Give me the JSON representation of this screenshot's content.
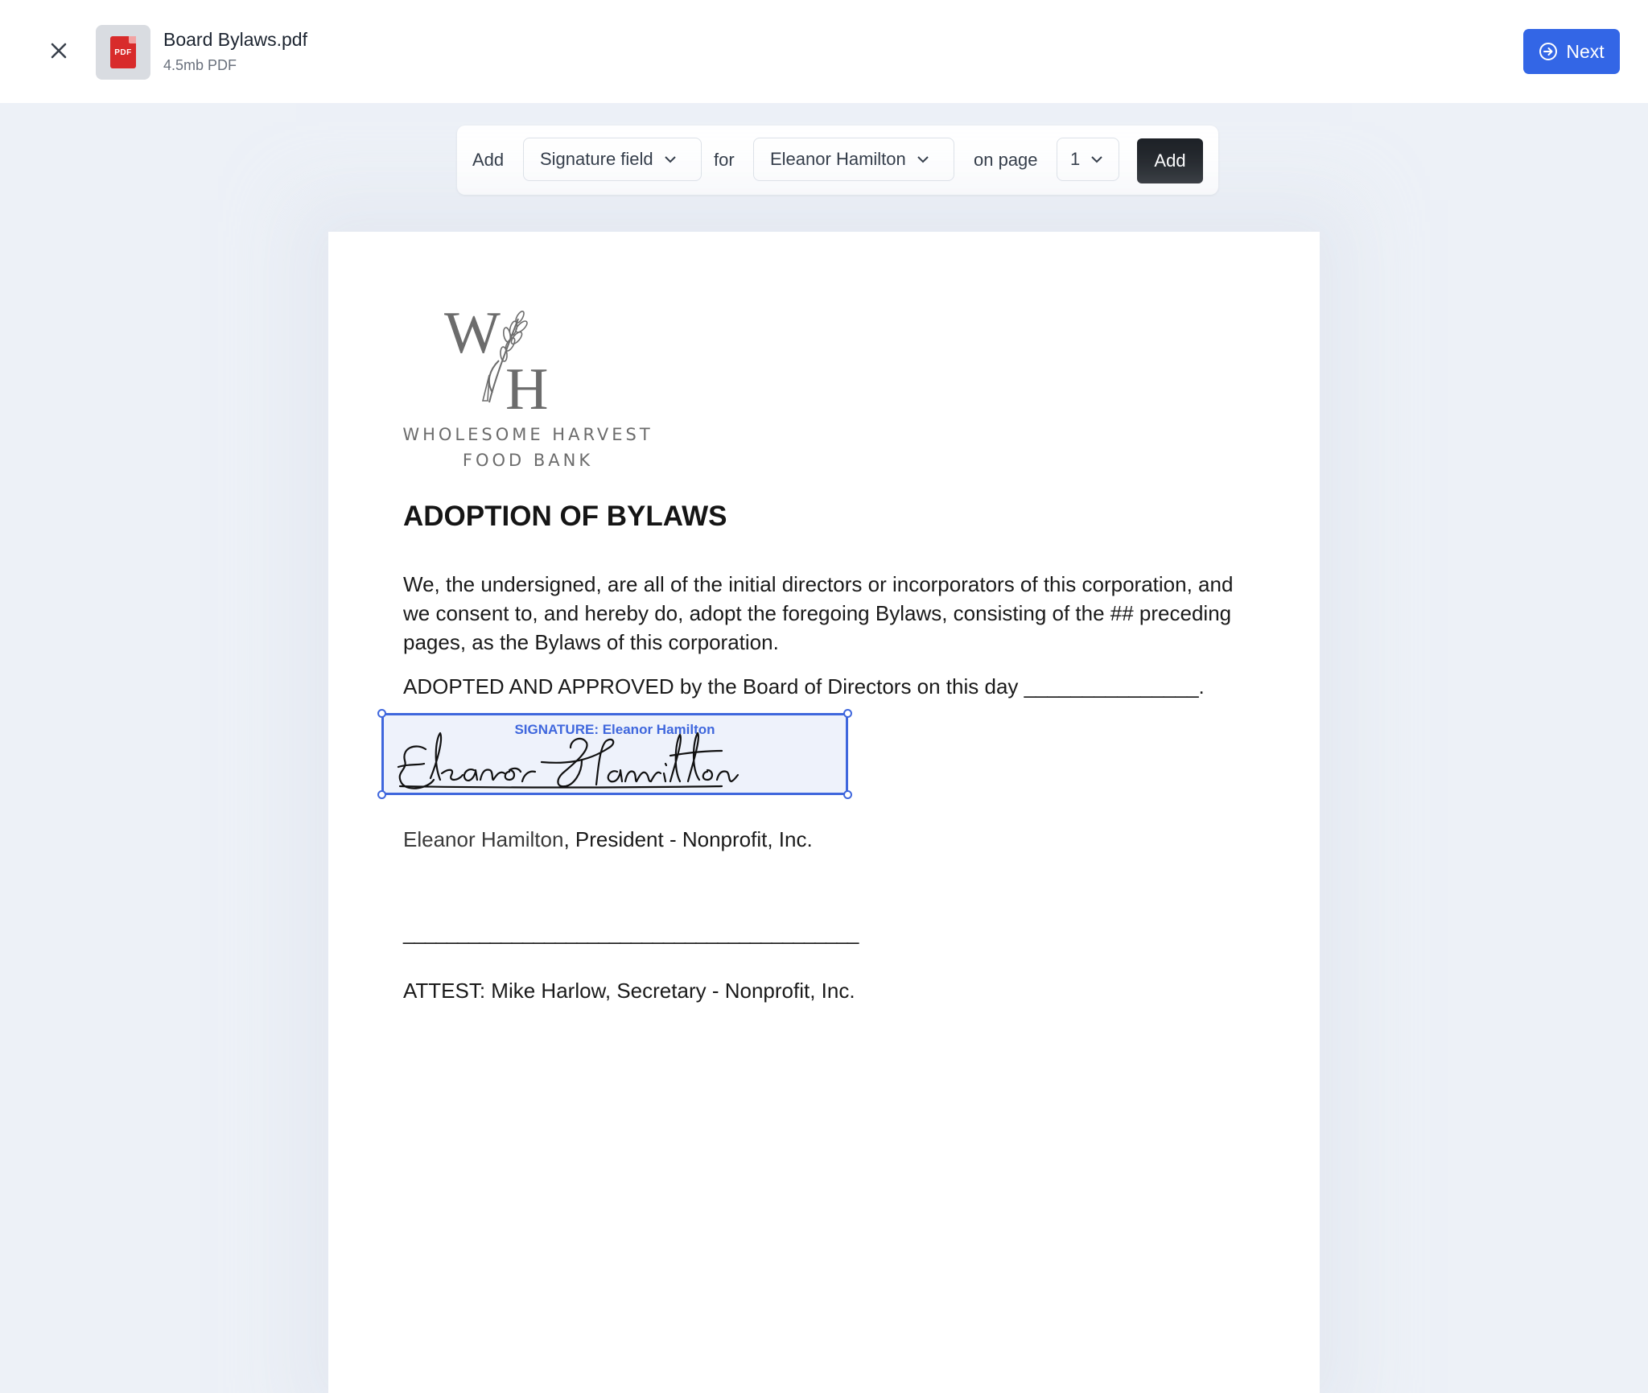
{
  "header": {
    "file_name": "Board Bylaws.pdf",
    "file_meta": "4.5mb PDF",
    "file_badge": "PDF",
    "next_label": "Next",
    "accent_color": "#3366e6"
  },
  "toolbar": {
    "add_text": "Add",
    "field_type": "Signature field",
    "for_text": "for",
    "signer": "Eleanor Hamilton",
    "on_page_text": "on page",
    "page_number": "1",
    "add_button_label": "Add"
  },
  "document": {
    "logo_line1": "WHOLESOME HARVEST",
    "logo_line2": "FOOD BANK",
    "title": "ADOPTION OF BYLAWS",
    "paragraph": "We, the undersigned, are all of the initial directors or incorporators of this corporation, and we consent to, and hereby do, adopt the foregoing Bylaws, consisting of the ## preceding pages, as the Bylaws of this corporation.",
    "adopted_line": "ADOPTED AND APPROVED by the Board of Directors on this day _______________.",
    "signature_field_label": "SIGNATURE: Eleanor Hamilton",
    "signer_name": "Eleanor Hamilton",
    "signer_role": ", President - Nonprofit, Inc.",
    "blank_line": "__________________________________________",
    "attest_line": "ATTEST: Mike Harlow, Secretary - Nonprofit, Inc."
  }
}
